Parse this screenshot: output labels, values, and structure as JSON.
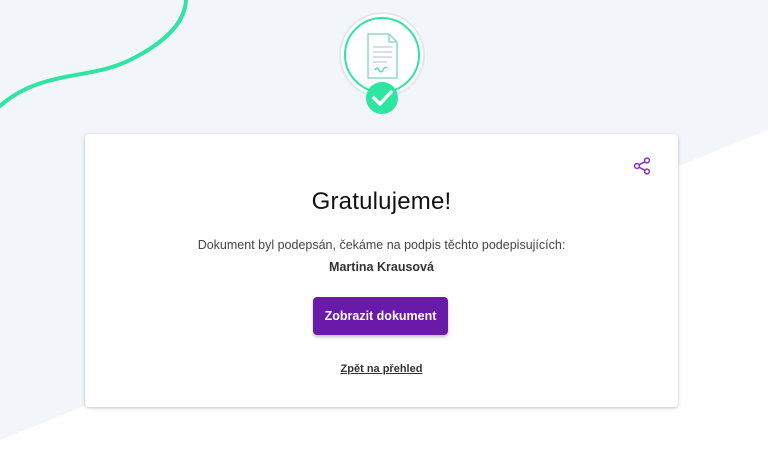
{
  "icons": {
    "document": "document-check-icon",
    "share": "share-icon"
  },
  "colors": {
    "accent": "#2ee5a2",
    "primary": "#6a1aa8"
  },
  "card": {
    "title": "Gratulujeme!",
    "message": "Dokument byl podepsán, čekáme na podpis těchto podepisujících:",
    "signer": "Martina Krausová",
    "primary_button": "Zobrazit dokument",
    "back_link": "Zpět na přehled"
  }
}
